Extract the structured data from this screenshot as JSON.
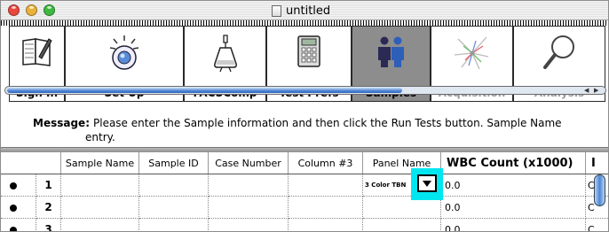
{
  "window": {
    "title": "untitled",
    "colors": {
      "close": "#e8483e",
      "minimize": "#e9b23a",
      "zoom": "#3fb842",
      "highlight": "#00e6f0",
      "active_tool": "#8d8d8d"
    }
  },
  "toolbar": {
    "buttons": [
      {
        "label": "Sign In",
        "icon": "book-pencil-icon",
        "active": false,
        "enabled": true
      },
      {
        "label": "Set Up",
        "icon": "light-bulb-icon",
        "active": false,
        "enabled": true
      },
      {
        "label": "FACSComp",
        "icon": "flask-funnel-icon",
        "active": false,
        "enabled": true
      },
      {
        "label": "Test Prefs",
        "icon": "calculator-icon",
        "active": false,
        "enabled": true
      },
      {
        "label": "Samples",
        "icon": "people-icon",
        "active": true,
        "enabled": true
      },
      {
        "label": "Acquisition",
        "icon": "laser-burst-icon",
        "active": false,
        "enabled": false
      },
      {
        "label": "Analysis",
        "icon": "magnifier-icon",
        "active": false,
        "enabled": false
      }
    ]
  },
  "message": {
    "label": "Message:",
    "line1": "Please enter the Sample information and then click the Run Tests button. Sample Name",
    "line2": "entry."
  },
  "table": {
    "columns": [
      "Sample Name",
      "Sample ID",
      "Case Number",
      "Column #3",
      "Panel Name",
      "WBC Count (x1000)",
      "I"
    ],
    "rows": [
      {
        "num": "1",
        "panel": "3 Color TBN",
        "wbc": "0.0",
        "next": "C"
      },
      {
        "num": "2",
        "panel": "",
        "wbc": "0.0",
        "next": "C"
      },
      {
        "num": "3",
        "panel": "",
        "wbc": "0.0",
        "next": "C"
      }
    ]
  }
}
